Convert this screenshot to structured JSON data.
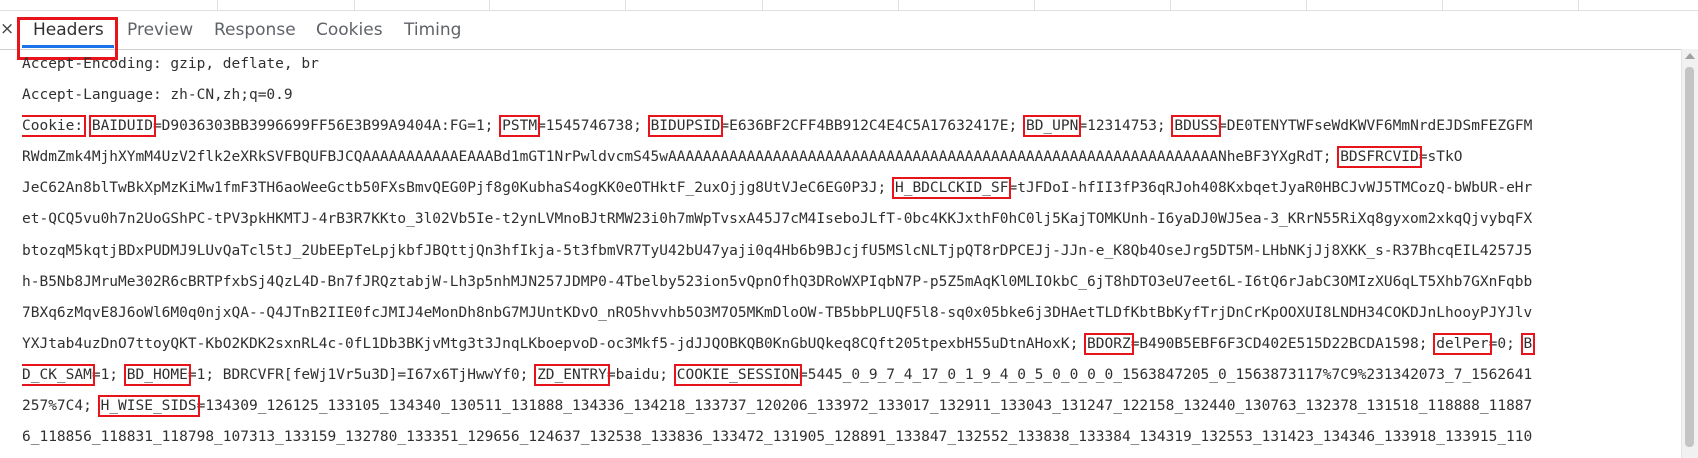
{
  "tabs": {
    "close": "×",
    "headers": "Headers",
    "preview": "Preview",
    "response": "Response",
    "cookies": "Cookies",
    "timing": "Timing"
  },
  "headers": {
    "accept_encoding": "Accept-Encoding: gzip, deflate, br",
    "accept_language": "Accept-Language: zh-CN,zh;q=0.9"
  },
  "cookie": {
    "label": "Cookie:",
    "lines": [
      [
        {
          "t": "BAIDUID",
          "hl": true
        },
        {
          "t": "=D9036303BB3996699FF56E3B99A9404A:FG=1; "
        },
        {
          "t": "PSTM",
          "hl": true
        },
        {
          "t": "=1545746738; "
        },
        {
          "t": "BIDUPSID",
          "hl": true
        },
        {
          "t": "=E636BF2CFF4BB912C4E4C5A17632417E; "
        },
        {
          "t": "BD_UPN",
          "hl": true
        },
        {
          "t": "=12314753; "
        },
        {
          "t": "BDUSS",
          "hl": true
        },
        {
          "t": "=DE0TENYTWFseWdKWVF6MmNrdEJDSmFEZGFM"
        }
      ],
      [
        {
          "t": "RWdmZmk4MjhXYmM4UzV2flk2eXRkSVFBQUFBJCQAAAAAAAAAAAEAAABd1mGT1NrPwldvcmS45wAAAAAAAAAAAAAAAAAAAAAAAAAAAAAAAAAAAAAAAAAAAAAAAAAAAAAAAAAAAAAAANheBF3YXgRdT; "
        },
        {
          "t": "BDSFRCVID",
          "hl": true
        },
        {
          "t": "=sTkO"
        }
      ],
      [
        {
          "t": "JeC62An8blTwBkXpMzKiMw1fmF3TH6aoWeeGctb50FXsBmvQEG0Pjf8g0KubhaS4ogKK0eOTHktF_2uxOjjg8UtVJeC6EG0P3J; "
        },
        {
          "t": "H_BDCLCKID_SF",
          "hl": true
        },
        {
          "t": "=tJFDoI-hfII3fP36qRJoh408KxbqetJyaR0HBCJvWJ5TMCozQ-bWbUR-eHr"
        }
      ],
      [
        {
          "t": "et-QCQ5vu0h7n2UoGShPC-tPV3pkHKMTJ-4rB3R7KKto_3l02Vb5Ie-t2ynLVMnoBJtRMW23i0h7mWpTvsxA45J7cM4IseboJLfT-0bc4KKJxthF0hC0lj5KajTOMKUnh-I6yaDJ0WJ5ea-3_KRrN55RiXq8gyxom2xkqQjvybqFX"
        }
      ],
      [
        {
          "t": "btozqM5kqtjBDxPUDMJ9LUvQaTcl5tJ_2UbEEpTeLpjkbfJBQttjQn3hfIkja-5t3fbmVR7TyU42bU47yaji0q4Hb6b9BJcjfU5MSlcNLTjpQT8rDPCEJj-JJn-e_K8Qb4OseJrg5DT5M-LHbNKjJj8XKK_s-R37BhcqEIL4257J5"
        }
      ],
      [
        {
          "t": "h-B5Nb8JMruMe302R6cBRTPfxbSj4QzL4D-Bn7fJRQztabjW-Lh3p5nhMJN257JDMP0-4Tbelby523ion5vQpnOfhQ3DRoWXPIqbN7P-p5Z5mAqKl0MLIOkbC_6jT8hDTO3eU7eet6L-I6tQ6rJabC3OMIzXU6qLT5Xhb7GXnFqbb"
        }
      ],
      [
        {
          "t": "7BXq6zMqvE8J6oWl6M0q0njxQA--Q4JTnB2IIE0fcJMIJ4eMonDh8nbG7MJUntKDvO_nRO5hvvhb5O3M7O5MKmDloOW-TB5bbPLUQF5l8-sq0x05bke6j3DHAetTLDfKbtBbKyfTrjDnCrKpOOXUI8LNDH34COKDJnLhooyPJYJlv"
        }
      ],
      [
        {
          "t": "YXJtab4uzDnO7ttoyQKT-KbO2KDK2sxnRL4c-0fL1Db3BKjvMtg3t3JnqLKboepvoD-oc3Mkf5-jdJJQOBKQB0KnGbUQkeq8CQft205tpexbH55uDtnAHoxK; "
        },
        {
          "t": "BDORZ",
          "hl": true
        },
        {
          "t": "=B490B5EBF6F3CD402E515D22BCDA1598; "
        },
        {
          "t": "delPer",
          "hl": true
        },
        {
          "t": "=0; "
        },
        {
          "t": "B",
          "hl": true
        }
      ],
      [
        {
          "t": "D_CK_SAM",
          "hl": true
        },
        {
          "t": "=1; "
        },
        {
          "t": "BD_HOME",
          "hl": true
        },
        {
          "t": "=1; BDRCVFR[feWj1Vr5u3D]=I67x6TjHwwYf0; "
        },
        {
          "t": "ZD_ENTRY",
          "hl": true
        },
        {
          "t": "=baidu; "
        },
        {
          "t": "COOKIE_SESSION",
          "hl": true
        },
        {
          "t": "=5445_0_9_7_4_17_0_1_9_4_0_5_0_0_0_0_1563847205_0_1563873117%7C9%231342073_7_1562641"
        }
      ],
      [
        {
          "t": "257%7C4; "
        },
        {
          "t": "H_WISE_SIDS",
          "hl": true
        },
        {
          "t": "=134309_126125_133105_134340_130511_131888_134336_134218_133737_120206_133972_133017_132911_133043_131247_122158_132440_130763_132378_131518_118888_11887"
        }
      ],
      [
        {
          "t": "6_118856_118831_118798_107313_133159_132780_133351_129656_124637_132538_133836_133472_131905_128891_133847_132552_133838_133384_134319_132553_131423_134346_133918_133915_110"
        }
      ]
    ]
  }
}
